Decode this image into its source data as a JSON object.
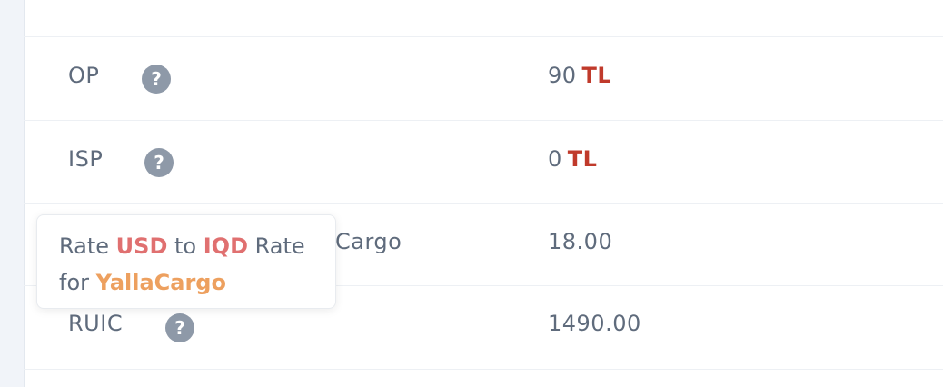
{
  "rows": [
    {
      "label": "OP",
      "value": "90",
      "currency": "TL"
    },
    {
      "label": "ISP",
      "value": "0",
      "currency": "TL"
    },
    {
      "label_partial": "Cargo",
      "value": "18.00"
    },
    {
      "label": "RUIC",
      "value": "1490.00"
    }
  ],
  "help_icon_glyph": "?",
  "tooltip": {
    "w1": "Rate",
    "from": "USD",
    "w2": "to",
    "to": "IQD",
    "w3": "Rate",
    "w4": "for",
    "company": "YallaCargo"
  },
  "colors": {
    "label_text": "#5f6b7c",
    "currency": "#c03a2b",
    "tooltip_highlight_red": "#e07070",
    "tooltip_highlight_orange": "#eda05f",
    "help_icon_bg": "#8e99a8"
  }
}
